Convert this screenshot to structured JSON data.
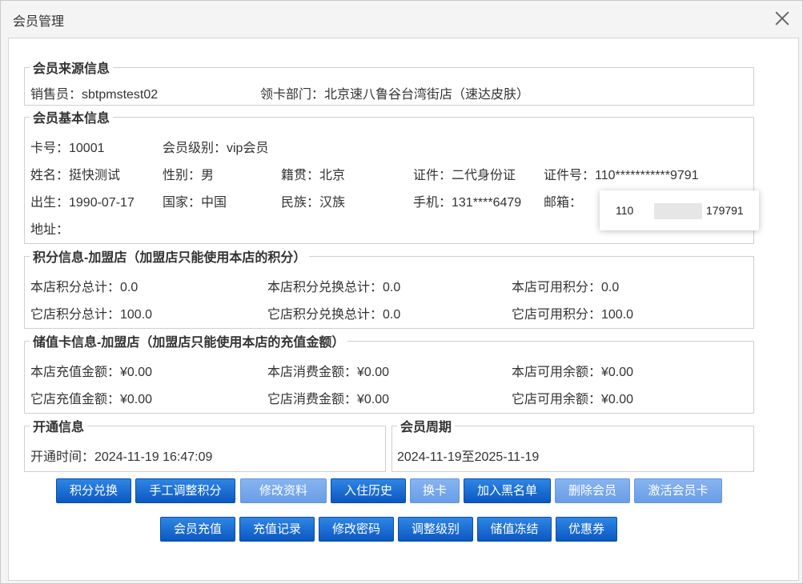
{
  "window": {
    "title": "会员管理"
  },
  "source": {
    "legend": "会员来源信息",
    "salesperson": "销售员：sbtpmstest02",
    "department": "领卡部门：北京速八鲁谷台湾街店（速达皮肤）"
  },
  "basic": {
    "legend": "会员基本信息",
    "card_no": "卡号：10001",
    "level": "会员级别：vip会员",
    "name": "姓名：挺快测试",
    "gender": "性别：男",
    "native": "籍贯：北京",
    "id_type": "证件：二代身份证",
    "id_no": "证件号：110***********9791",
    "birth": "出生：1990-07-17",
    "country": "国家：中国",
    "ethnicity": "民族：汉族",
    "mobile": "手机：131****6479",
    "email": "邮箱：",
    "address": "地址：",
    "tooltip_prefix": "110",
    "tooltip_suffix": "179791"
  },
  "points": {
    "legend": "积分信息-加盟店（加盟店只能使用本店的积分）",
    "row1": [
      "本店积分总计：0.0",
      "本店积分兑换总计：0.0",
      "本店可用积分：0.0"
    ],
    "row2": [
      "它店积分总计：100.0",
      "它店积分兑换总计：0.0",
      "它店可用积分：100.0"
    ]
  },
  "stored": {
    "legend": "储值卡信息-加盟店（加盟店只能使用本店的充值金额）",
    "row1": [
      "本店充值金额：¥0.00",
      "本店消费金额：¥0.00",
      "本店可用余额：¥0.00"
    ],
    "row2": [
      "它店充值金额：¥0.00",
      "它店消费金额：¥0.00",
      "它店可用余额：¥0.00"
    ]
  },
  "open": {
    "legend": "开通信息",
    "time": "开通时间：2024-11-19 16:47:09"
  },
  "period": {
    "legend": "会员周期",
    "range": "2024-11-19至2025-11-19"
  },
  "buttons_row1": [
    "积分兑换",
    "手工调整积分",
    "修改资料",
    "入住历史",
    "换卡",
    "加入黑名单",
    "删除会员",
    "激活会员卡"
  ],
  "buttons_row2": [
    "会员充值",
    "充值记录",
    "修改密码",
    "调整级别",
    "储值冻结",
    "优惠券"
  ],
  "colors": {
    "button_primary": "#1565d0",
    "button_disabled": "#7aa9ec",
    "dialog_bg": "#f4f4f4"
  },
  "icons": {
    "close": "close-icon"
  }
}
